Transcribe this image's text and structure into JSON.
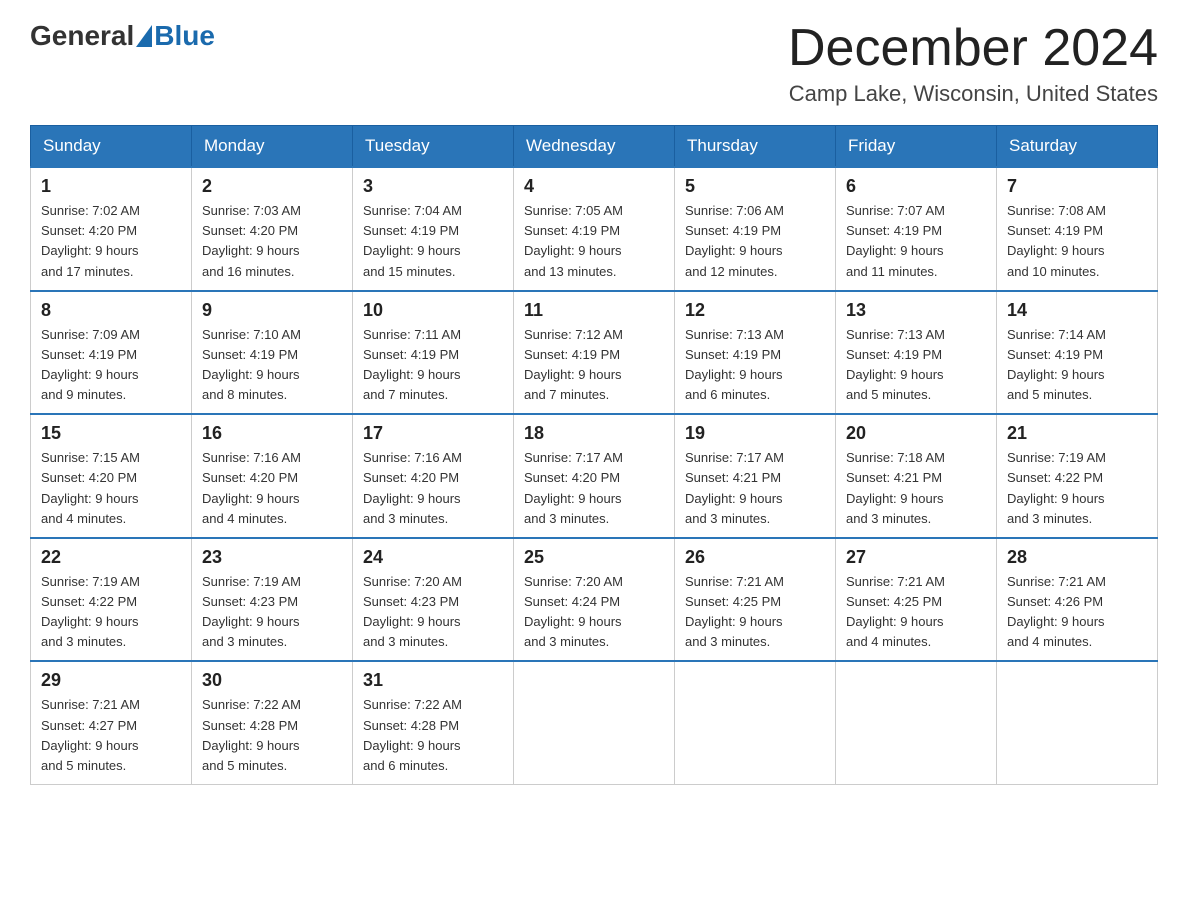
{
  "header": {
    "logo_general": "General",
    "logo_blue": "Blue",
    "month": "December 2024",
    "location": "Camp Lake, Wisconsin, United States"
  },
  "weekdays": [
    "Sunday",
    "Monday",
    "Tuesday",
    "Wednesday",
    "Thursday",
    "Friday",
    "Saturday"
  ],
  "weeks": [
    [
      {
        "day": "1",
        "sunrise": "7:02 AM",
        "sunset": "4:20 PM",
        "daylight": "9 hours and 17 minutes."
      },
      {
        "day": "2",
        "sunrise": "7:03 AM",
        "sunset": "4:20 PM",
        "daylight": "9 hours and 16 minutes."
      },
      {
        "day": "3",
        "sunrise": "7:04 AM",
        "sunset": "4:19 PM",
        "daylight": "9 hours and 15 minutes."
      },
      {
        "day": "4",
        "sunrise": "7:05 AM",
        "sunset": "4:19 PM",
        "daylight": "9 hours and 13 minutes."
      },
      {
        "day": "5",
        "sunrise": "7:06 AM",
        "sunset": "4:19 PM",
        "daylight": "9 hours and 12 minutes."
      },
      {
        "day": "6",
        "sunrise": "7:07 AM",
        "sunset": "4:19 PM",
        "daylight": "9 hours and 11 minutes."
      },
      {
        "day": "7",
        "sunrise": "7:08 AM",
        "sunset": "4:19 PM",
        "daylight": "9 hours and 10 minutes."
      }
    ],
    [
      {
        "day": "8",
        "sunrise": "7:09 AM",
        "sunset": "4:19 PM",
        "daylight": "9 hours and 9 minutes."
      },
      {
        "day": "9",
        "sunrise": "7:10 AM",
        "sunset": "4:19 PM",
        "daylight": "9 hours and 8 minutes."
      },
      {
        "day": "10",
        "sunrise": "7:11 AM",
        "sunset": "4:19 PM",
        "daylight": "9 hours and 7 minutes."
      },
      {
        "day": "11",
        "sunrise": "7:12 AM",
        "sunset": "4:19 PM",
        "daylight": "9 hours and 7 minutes."
      },
      {
        "day": "12",
        "sunrise": "7:13 AM",
        "sunset": "4:19 PM",
        "daylight": "9 hours and 6 minutes."
      },
      {
        "day": "13",
        "sunrise": "7:13 AM",
        "sunset": "4:19 PM",
        "daylight": "9 hours and 5 minutes."
      },
      {
        "day": "14",
        "sunrise": "7:14 AM",
        "sunset": "4:19 PM",
        "daylight": "9 hours and 5 minutes."
      }
    ],
    [
      {
        "day": "15",
        "sunrise": "7:15 AM",
        "sunset": "4:20 PM",
        "daylight": "9 hours and 4 minutes."
      },
      {
        "day": "16",
        "sunrise": "7:16 AM",
        "sunset": "4:20 PM",
        "daylight": "9 hours and 4 minutes."
      },
      {
        "day": "17",
        "sunrise": "7:16 AM",
        "sunset": "4:20 PM",
        "daylight": "9 hours and 3 minutes."
      },
      {
        "day": "18",
        "sunrise": "7:17 AM",
        "sunset": "4:20 PM",
        "daylight": "9 hours and 3 minutes."
      },
      {
        "day": "19",
        "sunrise": "7:17 AM",
        "sunset": "4:21 PM",
        "daylight": "9 hours and 3 minutes."
      },
      {
        "day": "20",
        "sunrise": "7:18 AM",
        "sunset": "4:21 PM",
        "daylight": "9 hours and 3 minutes."
      },
      {
        "day": "21",
        "sunrise": "7:19 AM",
        "sunset": "4:22 PM",
        "daylight": "9 hours and 3 minutes."
      }
    ],
    [
      {
        "day": "22",
        "sunrise": "7:19 AM",
        "sunset": "4:22 PM",
        "daylight": "9 hours and 3 minutes."
      },
      {
        "day": "23",
        "sunrise": "7:19 AM",
        "sunset": "4:23 PM",
        "daylight": "9 hours and 3 minutes."
      },
      {
        "day": "24",
        "sunrise": "7:20 AM",
        "sunset": "4:23 PM",
        "daylight": "9 hours and 3 minutes."
      },
      {
        "day": "25",
        "sunrise": "7:20 AM",
        "sunset": "4:24 PM",
        "daylight": "9 hours and 3 minutes."
      },
      {
        "day": "26",
        "sunrise": "7:21 AM",
        "sunset": "4:25 PM",
        "daylight": "9 hours and 3 minutes."
      },
      {
        "day": "27",
        "sunrise": "7:21 AM",
        "sunset": "4:25 PM",
        "daylight": "9 hours and 4 minutes."
      },
      {
        "day": "28",
        "sunrise": "7:21 AM",
        "sunset": "4:26 PM",
        "daylight": "9 hours and 4 minutes."
      }
    ],
    [
      {
        "day": "29",
        "sunrise": "7:21 AM",
        "sunset": "4:27 PM",
        "daylight": "9 hours and 5 minutes."
      },
      {
        "day": "30",
        "sunrise": "7:22 AM",
        "sunset": "4:28 PM",
        "daylight": "9 hours and 5 minutes."
      },
      {
        "day": "31",
        "sunrise": "7:22 AM",
        "sunset": "4:28 PM",
        "daylight": "9 hours and 6 minutes."
      },
      null,
      null,
      null,
      null
    ]
  ],
  "labels": {
    "sunrise": "Sunrise:",
    "sunset": "Sunset:",
    "daylight": "Daylight:"
  }
}
